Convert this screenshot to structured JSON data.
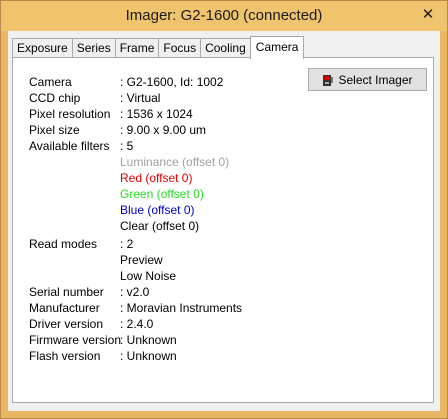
{
  "window": {
    "title": "Imager: G2-1600 (connected)",
    "close_symbol": "✕"
  },
  "tabs": [
    {
      "label": "Exposure"
    },
    {
      "label": "Series"
    },
    {
      "label": "Frame"
    },
    {
      "label": "Focus"
    },
    {
      "label": "Cooling"
    },
    {
      "label": "Camera",
      "active": true
    }
  ],
  "select_imager_button": {
    "label": "Select Imager",
    "icon": "camera-icon"
  },
  "info": {
    "camera": {
      "label": "Camera",
      "value": ": G2-1600, Id: 1002"
    },
    "ccd_chip": {
      "label": "CCD chip",
      "value": ": Virtual"
    },
    "pixel_resolution": {
      "label": "Pixel resolution",
      "value": ": 1536 x 1024"
    },
    "pixel_size": {
      "label": "Pixel size",
      "value": ": 9.00 x 9.00 um"
    },
    "available_filters": {
      "label": "Available filters",
      "value": ": 5"
    },
    "filters": [
      {
        "name": "Luminance (offset 0)",
        "color": "#a0a0a0"
      },
      {
        "name": "Red (offset 0)",
        "color": "#e00000"
      },
      {
        "name": "Green (offset 0)",
        "color": "#22dd22"
      },
      {
        "name": "Blue (offset 0)",
        "color": "#0000cc"
      },
      {
        "name": "Clear (offset 0)",
        "color": "#000000"
      }
    ],
    "read_modes": {
      "label": "Read modes",
      "value": ": 2"
    },
    "modes": [
      "Preview",
      "Low Noise"
    ],
    "serial_number": {
      "label": "Serial number",
      "value": ": v2.0"
    },
    "manufacturer": {
      "label": "Manufacturer",
      "value": ": Moravian Instruments"
    },
    "driver_version": {
      "label": "Driver version",
      "value": ": 2.4.0"
    },
    "firmware_version": {
      "label": "Firmware version",
      "value": ": Unknown"
    },
    "flash_version": {
      "label": "Flash version",
      "value": ": Unknown"
    }
  }
}
